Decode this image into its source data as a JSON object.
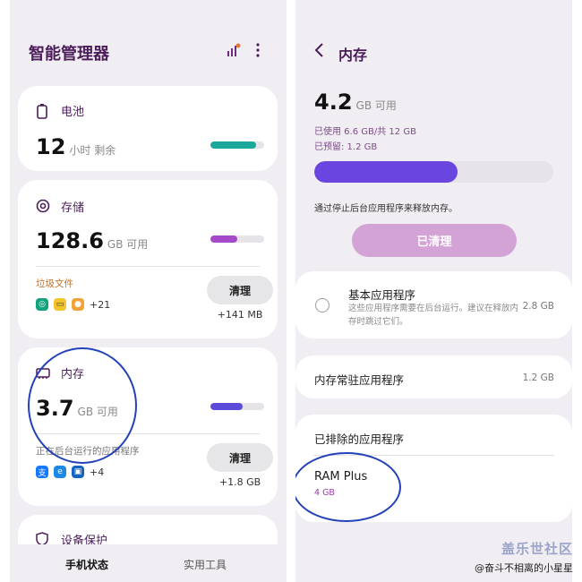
{
  "left": {
    "title": "智能管理器",
    "battery": {
      "label": "电池",
      "value": "12",
      "unit": "小时 剩余",
      "fill": 0.85,
      "color": "#1aa89a"
    },
    "storage": {
      "label": "存储",
      "value": "128.6",
      "unit": "GB 可用",
      "fill": 0.5,
      "color": "#a54bc9",
      "junk_label": "垃圾文件",
      "app_count": "+21",
      "clean_label": "清理",
      "clean_size": "+141 MB"
    },
    "memory": {
      "label": "内存",
      "value": "3.7",
      "unit": "GB 可用",
      "fill": 0.6,
      "color": "#5c4ad8",
      "bg_label": "正在后台运行的应用程序",
      "app_count": "+4",
      "clean_label": "清理",
      "clean_size": "+1.8 GB"
    },
    "device": {
      "label": "设备保护"
    },
    "nav": {
      "tab1": "手机状态",
      "tab2": "实用工具"
    }
  },
  "right": {
    "title": "内存",
    "available": "4.2",
    "unit": "GB 可用",
    "used": "已使用 6.6 GB/共 12 GB",
    "reserved": "已预留: 1.2 GB",
    "fill": 0.6,
    "color": "#6b45e0",
    "note": "通过停止后台应用程序来释放内存。",
    "cleaned_btn": "已清理",
    "basic_apps": {
      "title": "基本应用程序",
      "desc": "这些应用程序需要在后台运行。建议在释放内存时跳过它们。",
      "size": "2.8 GB"
    },
    "resident_apps": {
      "title": "内存常驻应用程序",
      "size": "1.2 GB"
    },
    "excluded": {
      "title": "已排除的应用程序",
      "ram_plus": "RAM Plus",
      "ram_plus_size": "4 GB"
    }
  },
  "watermark": {
    "line1": "盖乐世社区",
    "line2": "@奋斗不相离的小星星"
  },
  "colors": {
    "accent_purple": "#4b1d5a",
    "annotation_blue": "#2442b8"
  }
}
